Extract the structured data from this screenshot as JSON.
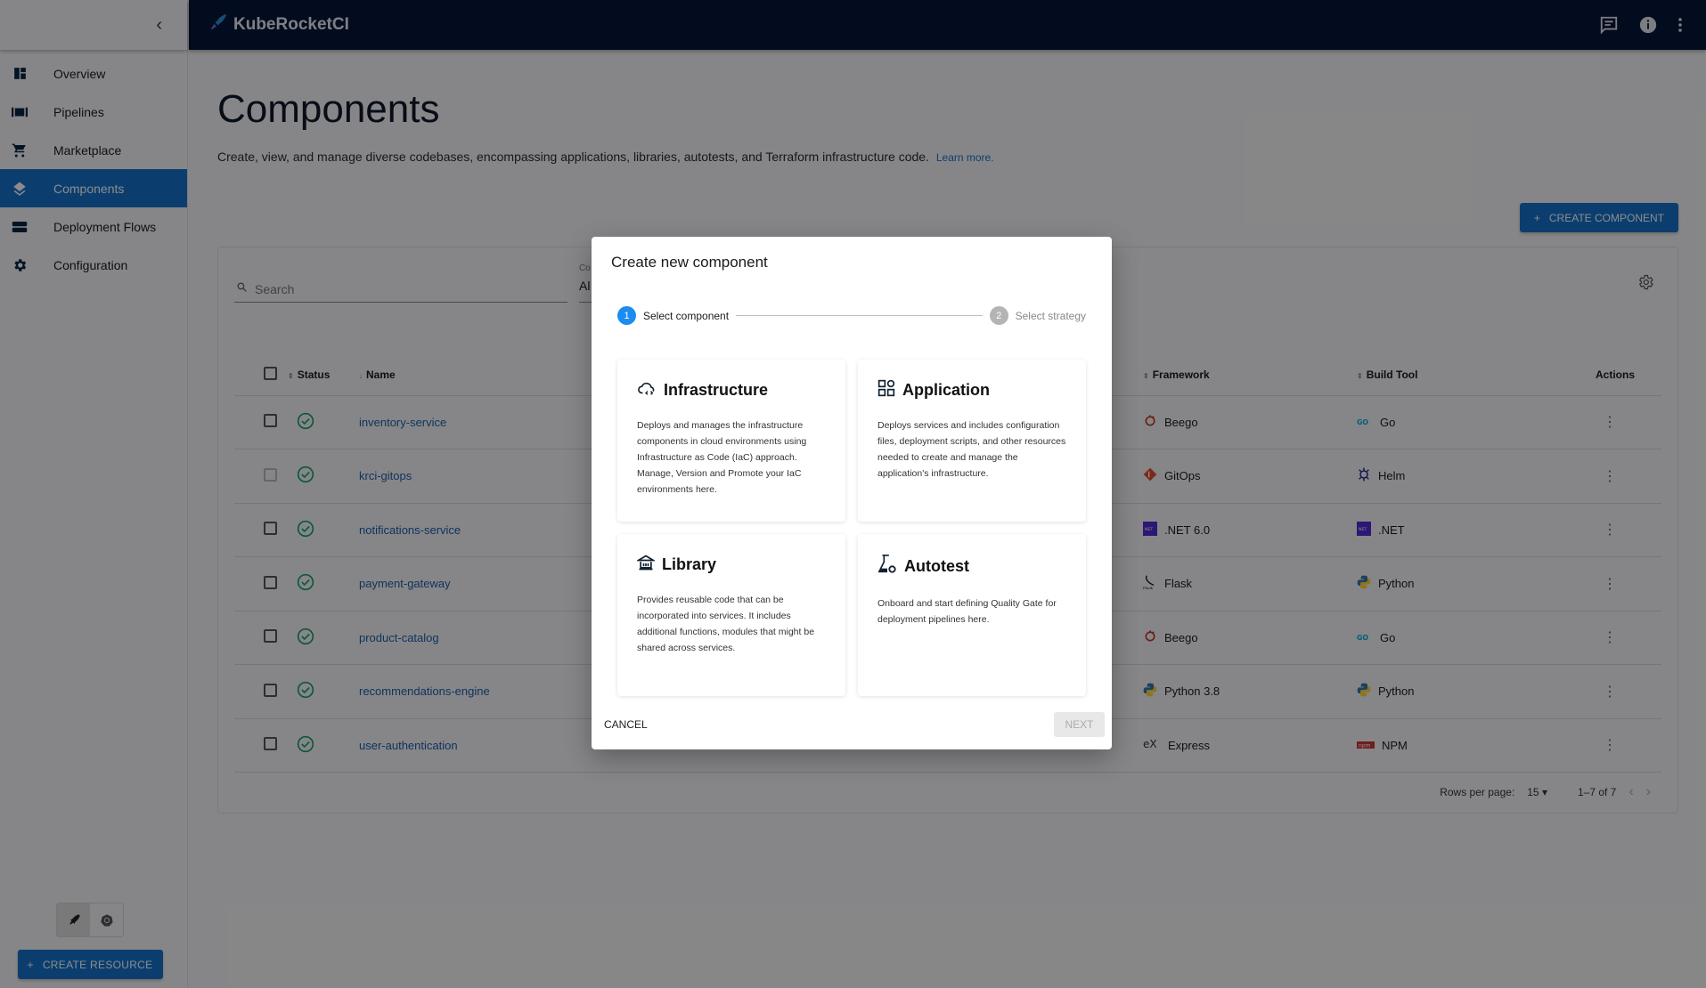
{
  "app": {
    "brand": "KubeRocketCI",
    "header_icons": [
      "chat-icon",
      "info-icon",
      "more-vert-icon"
    ]
  },
  "sidebar": {
    "items": [
      {
        "label": "Overview",
        "icon": "dashboard-icon",
        "active": false
      },
      {
        "label": "Pipelines",
        "icon": "pipelines-icon",
        "active": false
      },
      {
        "label": "Marketplace",
        "icon": "cart-icon",
        "active": false
      },
      {
        "label": "Components",
        "icon": "layers-icon",
        "active": true
      },
      {
        "label": "Deployment Flows",
        "icon": "flows-icon",
        "active": false
      },
      {
        "label": "Configuration",
        "icon": "gear-icon",
        "active": false
      }
    ],
    "create_resource_label": "CREATE RESOURCE"
  },
  "page": {
    "title": "Components",
    "description": "Create, view, and manage diverse codebases, encompassing applications, libraries, autotests, and Terraform infrastructure code.",
    "learn_more": "Learn more.",
    "create_component_label": "CREATE COMPONENT"
  },
  "table": {
    "search_placeholder": "Search",
    "filter_label": "Co",
    "filter_value": "Al",
    "columns": {
      "status": "Status",
      "name": "Name",
      "framework": "Framework",
      "build_tool": "Build Tool",
      "actions": "Actions"
    },
    "rows": [
      {
        "name": "inventory-service",
        "status": "ok",
        "framework": "Beego",
        "framework_icon": "beego-icon",
        "build_tool": "Go",
        "build_icon": "go-icon",
        "selectable": true
      },
      {
        "name": "krci-gitops",
        "status": "ok",
        "framework": "GitOps",
        "framework_icon": "git-icon",
        "build_tool": "Helm",
        "build_icon": "helm-icon",
        "selectable": false
      },
      {
        "name": "notifications-service",
        "status": "ok",
        "framework": ".NET 6.0",
        "framework_icon": "dotnet-icon",
        "build_tool": ".NET",
        "build_icon": "dotnet-icon",
        "selectable": true
      },
      {
        "name": "payment-gateway",
        "status": "ok",
        "framework": "Flask",
        "framework_icon": "flask-icon",
        "build_tool": "Python",
        "build_icon": "python-icon",
        "selectable": true
      },
      {
        "name": "product-catalog",
        "status": "ok",
        "framework": "Beego",
        "framework_icon": "beego-icon",
        "build_tool": "Go",
        "build_icon": "go-icon",
        "selectable": true
      },
      {
        "name": "recommendations-engine",
        "status": "ok",
        "framework": "Python 3.8",
        "framework_icon": "python-icon",
        "build_tool": "Python",
        "build_icon": "python-icon",
        "selectable": true
      },
      {
        "name": "user-authentication",
        "status": "ok",
        "framework": "Express",
        "framework_icon": "express-icon",
        "build_tool": "NPM",
        "build_icon": "npm-icon",
        "selectable": true
      }
    ],
    "pagination": {
      "rows_per_page_label": "Rows per page:",
      "rows_per_page": "15",
      "range": "1–7 of 7"
    }
  },
  "modal": {
    "title": "Create new component",
    "steps": [
      {
        "num": "1",
        "label": "Select component",
        "active": true
      },
      {
        "num": "2",
        "label": "Select strategy",
        "active": false
      }
    ],
    "cards": [
      {
        "title": "Infrastructure",
        "icon": "cloud-code-icon",
        "description": "Deploys and manages the infrastructure components in cloud environments using Infrastructure as Code (IaC) approach. Manage, Version and Promote your IaC environments here."
      },
      {
        "title": "Application",
        "icon": "apps-icon",
        "description": "Deploys services and includes configuration files, deployment scripts, and other resources needed to create and manage the application's infrastructure."
      },
      {
        "title": "Library",
        "icon": "library-icon",
        "description": "Provides reusable code that can be incorporated into services. It includes additional functions, modules that might be shared across services."
      },
      {
        "title": "Autotest",
        "icon": "flask-gear-icon",
        "description": "Onboard and start defining Quality Gate for deployment pipelines here."
      }
    ],
    "cancel_label": "CANCEL",
    "next_label": "NEXT"
  },
  "colors": {
    "primary": "#1472c8",
    "header_bg": "#061437",
    "success": "#18a16b",
    "step_active": "#1b8cf0"
  }
}
